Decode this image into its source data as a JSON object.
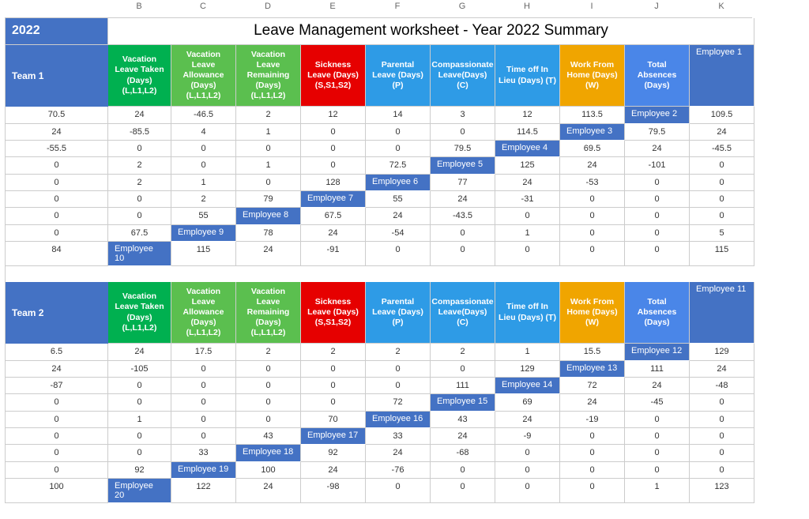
{
  "columns_letters": [
    "B",
    "C",
    "D",
    "E",
    "F",
    "G",
    "H",
    "I",
    "J",
    "K"
  ],
  "year": "2022",
  "title": "Leave Management worksheet - Year 2022 Summary",
  "headers": {
    "vac_taken": "Vacation Leave Taken (Days) (L,L1,L2)",
    "vac_allow": "Vacation Leave Allowance (Days) (L,L1,L2)",
    "vac_remain": "Vacation Leave Remaining (Days) (L,L1,L2)",
    "sick": "Sickness Leave (Days) (S,S1,S2)",
    "parental": "Parental Leave (Days) (P)",
    "compassionate": "Compassionate Leave(Days) (C)",
    "lieu": "Time off In Lieu (Days) (T)",
    "wfh": "Work From Home (Days) (W)",
    "total": "Total Absences (Days)"
  },
  "teams": [
    {
      "name": "Team 1",
      "rows": [
        {
          "emp": "Employee 1",
          "c": "70.5",
          "d": "24",
          "e": "-46.5",
          "f": "2",
          "g": "12",
          "h": "14",
          "i": "3",
          "j": "12",
          "k": "113.5"
        },
        {
          "emp": "Employee 2",
          "c": "109.5",
          "d": "24",
          "e": "-85.5",
          "f": "4",
          "g": "1",
          "h": "0",
          "i": "0",
          "j": "0",
          "k": "114.5"
        },
        {
          "emp": "Employee 3",
          "c": "79.5",
          "d": "24",
          "e": "-55.5",
          "f": "0",
          "g": "0",
          "h": "0",
          "i": "0",
          "j": "0",
          "k": "79.5"
        },
        {
          "emp": "Employee 4",
          "c": "69.5",
          "d": "24",
          "e": "-45.5",
          "f": "0",
          "g": "2",
          "h": "0",
          "i": "1",
          "j": "0",
          "k": "72.5"
        },
        {
          "emp": "Employee 5",
          "c": "125",
          "d": "24",
          "e": "-101",
          "f": "0",
          "g": "0",
          "h": "2",
          "i": "1",
          "j": "0",
          "k": "128"
        },
        {
          "emp": "Employee 6",
          "c": "77",
          "d": "24",
          "e": "-53",
          "f": "0",
          "g": "0",
          "h": "0",
          "i": "0",
          "j": "2",
          "k": "79"
        },
        {
          "emp": "Employee 7",
          "c": "55",
          "d": "24",
          "e": "-31",
          "f": "0",
          "g": "0",
          "h": "0",
          "i": "0",
          "j": "0",
          "k": "55"
        },
        {
          "emp": "Employee 8",
          "c": "67.5",
          "d": "24",
          "e": "-43.5",
          "f": "0",
          "g": "0",
          "h": "0",
          "i": "0",
          "j": "0",
          "k": "67.5"
        },
        {
          "emp": "Employee 9",
          "c": "78",
          "d": "24",
          "e": "-54",
          "f": "0",
          "g": "1",
          "h": "0",
          "i": "0",
          "j": "5",
          "k": "84"
        },
        {
          "emp": "Employee 10",
          "c": "115",
          "d": "24",
          "e": "-91",
          "f": "0",
          "g": "0",
          "h": "0",
          "i": "0",
          "j": "0",
          "k": "115"
        }
      ]
    },
    {
      "name": "Team 2",
      "rows": [
        {
          "emp": "Employee 11",
          "c": "6.5",
          "d": "24",
          "e": "17.5",
          "f": "2",
          "g": "2",
          "h": "2",
          "i": "2",
          "j": "1",
          "k": "15.5"
        },
        {
          "emp": "Employee 12",
          "c": "129",
          "d": "24",
          "e": "-105",
          "f": "0",
          "g": "0",
          "h": "0",
          "i": "0",
          "j": "0",
          "k": "129"
        },
        {
          "emp": "Employee 13",
          "c": "111",
          "d": "24",
          "e": "-87",
          "f": "0",
          "g": "0",
          "h": "0",
          "i": "0",
          "j": "0",
          "k": "111"
        },
        {
          "emp": "Employee 14",
          "c": "72",
          "d": "24",
          "e": "-48",
          "f": "0",
          "g": "0",
          "h": "0",
          "i": "0",
          "j": "0",
          "k": "72"
        },
        {
          "emp": "Employee 15",
          "c": "69",
          "d": "24",
          "e": "-45",
          "f": "0",
          "g": "0",
          "h": "1",
          "i": "0",
          "j": "0",
          "k": "70"
        },
        {
          "emp": "Employee 16",
          "c": "43",
          "d": "24",
          "e": "-19",
          "f": "0",
          "g": "0",
          "h": "0",
          "i": "0",
          "j": "0",
          "k": "43"
        },
        {
          "emp": "Employee 17",
          "c": "33",
          "d": "24",
          "e": "-9",
          "f": "0",
          "g": "0",
          "h": "0",
          "i": "0",
          "j": "0",
          "k": "33"
        },
        {
          "emp": "Employee 18",
          "c": "92",
          "d": "24",
          "e": "-68",
          "f": "0",
          "g": "0",
          "h": "0",
          "i": "0",
          "j": "0",
          "k": "92"
        },
        {
          "emp": "Employee 19",
          "c": "100",
          "d": "24",
          "e": "-76",
          "f": "0",
          "g": "0",
          "h": "0",
          "i": "0",
          "j": "0",
          "k": "100"
        },
        {
          "emp": "Employee 20",
          "c": "122",
          "d": "24",
          "e": "-98",
          "f": "0",
          "g": "0",
          "h": "0",
          "i": "0",
          "j": "1",
          "k": "123"
        }
      ]
    }
  ]
}
